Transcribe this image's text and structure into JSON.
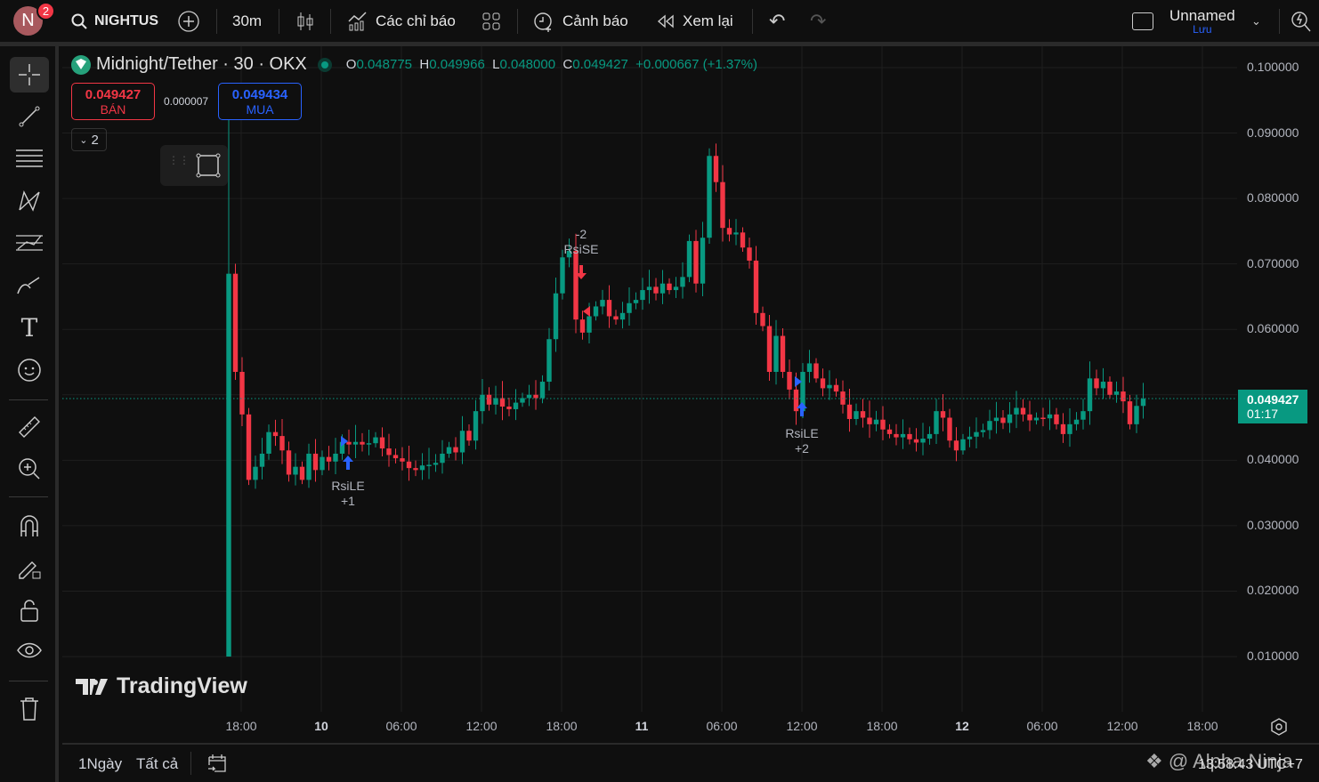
{
  "topbar": {
    "avatar_letter": "N",
    "notification_count": "2",
    "symbol": "NIGHTUS",
    "interval": "30m",
    "indicators_label": "Các chỉ báo",
    "alerts_label": "Cảnh báo",
    "replay_label": "Xem lại",
    "layout_name": "Unnamed",
    "save_label": "Lưu"
  },
  "legend": {
    "title": "Midnight/Tether · 30 · OKX",
    "o_label": "O",
    "o": "0.048775",
    "h_label": "H",
    "h": "0.049966",
    "l_label": "L",
    "l": "0.048000",
    "c_label": "C",
    "c": "0.049427",
    "change": "+0.000667 (+1.37%)"
  },
  "trade": {
    "sell_price": "0.049427",
    "sell_label": "BÁN",
    "spread": "0.000007",
    "buy_price": "0.049434",
    "buy_label": "MUA",
    "collapse_count": "2"
  },
  "price_axis": [
    "0.100000",
    "0.090000",
    "0.080000",
    "0.070000",
    "0.060000",
    "0.050000",
    "0.040000",
    "0.030000",
    "0.020000",
    "0.010000"
  ],
  "current": {
    "price": "0.049427",
    "countdown": "01:17"
  },
  "time_axis": [
    "18:00",
    "10",
    "06:00",
    "12:00",
    "18:00",
    "11",
    "06:00",
    "12:00",
    "18:00",
    "12",
    "06:00",
    "12:00",
    "18:00"
  ],
  "markers": [
    {
      "label": "RsiLE",
      "qty": "+1",
      "type": "long"
    },
    {
      "label": "RsiSE",
      "qty": "-2",
      "type": "short"
    },
    {
      "label": "RsiLE",
      "qty": "+2",
      "type": "long"
    }
  ],
  "watermark": "TradingView",
  "bottombar": {
    "range_1d": "1Ngày",
    "range_all": "Tất cả",
    "clock": "13:58:43 UTC+7",
    "overlay_watermark": "@ Alpha Ninja"
  },
  "colors": {
    "up": "#089981",
    "down": "#f23645",
    "buy": "#2962ff"
  },
  "chart_data": {
    "type": "candlestick",
    "interval_minutes": 30,
    "ylim": [
      0.0,
      0.1
    ],
    "first_open": 0.01,
    "first_high": 0.092,
    "first_low": 0.01,
    "closes": [
      0.0685,
      0.0535,
      0.047,
      0.037,
      0.039,
      0.041,
      0.0443,
      0.0437,
      0.0415,
      0.0378,
      0.039,
      0.037,
      0.041,
      0.0385,
      0.0405,
      0.0398,
      0.041,
      0.0428,
      0.0424,
      0.0428,
      0.0424,
      0.0426,
      0.0435,
      0.0418,
      0.0408,
      0.0403,
      0.0398,
      0.0388,
      0.0385,
      0.0392,
      0.0393,
      0.0396,
      0.041,
      0.042,
      0.0412,
      0.0445,
      0.043,
      0.0475,
      0.05,
      0.0485,
      0.0495,
      0.0482,
      0.0478,
      0.0488,
      0.0495,
      0.05,
      0.0495,
      0.052,
      0.0585,
      0.0655,
      0.071,
      0.072,
      0.0615,
      0.0595,
      0.062,
      0.0635,
      0.0645,
      0.062,
      0.0615,
      0.0625,
      0.064,
      0.0645,
      0.066,
      0.0665,
      0.0655,
      0.067,
      0.066,
      0.0665,
      0.068,
      0.0735,
      0.067,
      0.074,
      0.0865,
      0.0825,
      0.0755,
      0.0745,
      0.0748,
      0.0725,
      0.0705,
      0.0625,
      0.0605,
      0.0535,
      0.059,
      0.0535,
      0.0508,
      0.0475,
      0.0535,
      0.0548,
      0.0525,
      0.051,
      0.0515,
      0.0505,
      0.0485,
      0.0463,
      0.0475,
      0.0465,
      0.0455,
      0.0462,
      0.0447,
      0.044,
      0.0435,
      0.044,
      0.0432,
      0.0427,
      0.0433,
      0.044,
      0.0475,
      0.0465,
      0.043,
      0.0415,
      0.0432,
      0.0436,
      0.0443,
      0.0446,
      0.046,
      0.0465,
      0.0457,
      0.047,
      0.048,
      0.047,
      0.0461,
      0.0465,
      0.0464,
      0.047,
      0.0455,
      0.044,
      0.0455,
      0.0462,
      0.0475,
      0.0525,
      0.051,
      0.052,
      0.05,
      0.0505,
      0.049,
      0.0455,
      0.0483,
      0.0494
    ]
  }
}
